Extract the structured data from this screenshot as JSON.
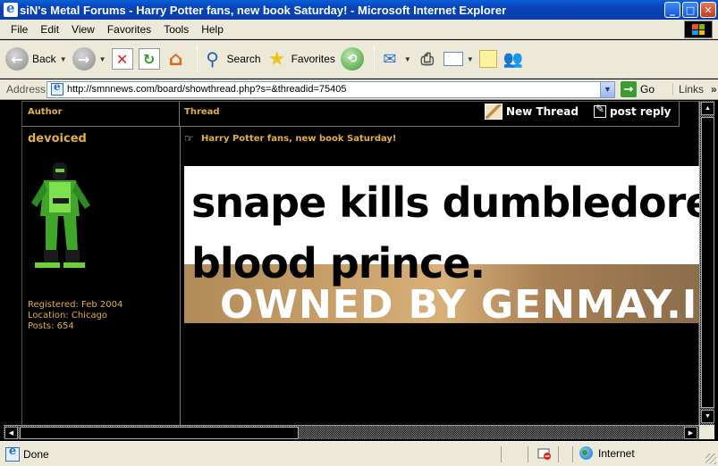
{
  "window": {
    "title": "siN's Metal Forums - Harry Potter fans, new book Saturday! - Microsoft Internet Explorer",
    "minimize_glyph": "_",
    "maximize_glyph": "□",
    "close_glyph": "✕"
  },
  "menubar": {
    "items": [
      "File",
      "Edit",
      "View",
      "Favorites",
      "Tools",
      "Help"
    ]
  },
  "toolbar": {
    "back_label": "Back",
    "search_label": "Search",
    "favorites_label": "Favorites"
  },
  "address": {
    "label": "Address",
    "url": "http://smnnews.com/board/showthread.php?s=&threadid=75405",
    "go_label": "Go",
    "links_label": "Links",
    "links_chevron": "»"
  },
  "forum": {
    "header_author": "Author",
    "header_thread": "Thread",
    "new_thread_label": "New Thread",
    "post_reply_label": "post reply"
  },
  "post": {
    "username": "devoiced",
    "registered": "Registered: Feb 2004",
    "location": "Location: Chicago",
    "posts": "Posts: 654",
    "title": "Harry Potter fans, new book Saturday!",
    "image_line1": "snape kills dumbledore, o",
    "image_line2": "blood prince.",
    "image_overlay": "OWNED BY GENMAY.I"
  },
  "statusbar": {
    "status": "Done",
    "zone": "Internet"
  },
  "colors": {
    "forum_accent": "#e0b040",
    "page_background": "#000000",
    "chrome": "#ece9d8",
    "titlebar": "#0842b8"
  }
}
